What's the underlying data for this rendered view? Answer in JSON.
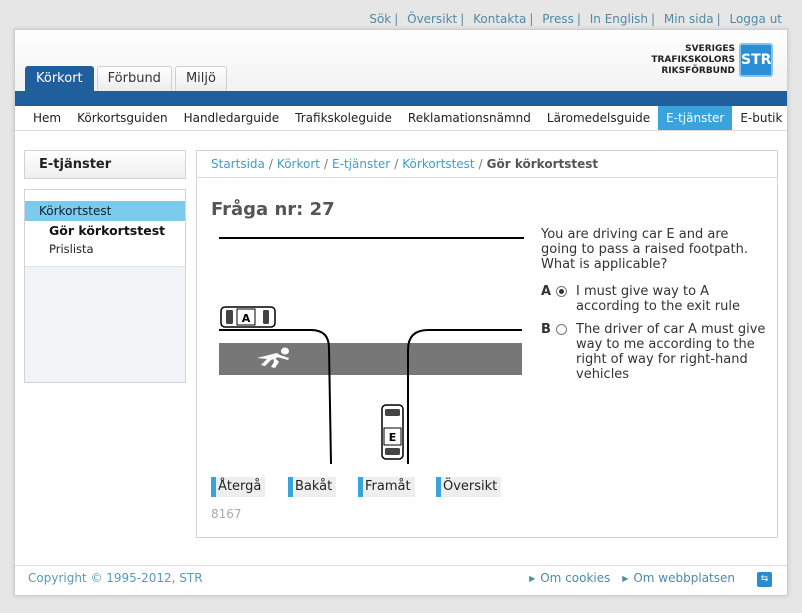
{
  "toplinks": [
    "Sök",
    "Översikt",
    "Kontakta",
    "Press",
    "In English",
    "Min sida",
    "Logga ut"
  ],
  "tabs": [
    {
      "label": "Körkort",
      "active": true
    },
    {
      "label": "Förbund",
      "active": false
    },
    {
      "label": "Miljö",
      "active": false
    }
  ],
  "logo": {
    "line1": "SVERIGES",
    "line2": "TRAFIKSKOLORS",
    "line3": "RIKSFÖRBUND",
    "box": "STR"
  },
  "mainnav": [
    "Hem",
    "Körkortsguiden",
    "Handledarguide",
    "Trafikskoleguide",
    "Reklamationsnämnd",
    "Läromedelsguide",
    "E-tjänster",
    "E-butik"
  ],
  "sidebar": {
    "title": "E-tjänster",
    "items": [
      "Körkortstest",
      "Gör körkortstest",
      "Prislista"
    ]
  },
  "breadcrumb": {
    "links": [
      "Startsida",
      "Körkort",
      "E-tjänster",
      "Körkortstest"
    ],
    "current": "Gör körkortstest"
  },
  "question": {
    "title": "Fråga nr: 27",
    "text": "You are driving car E and are going to pass a raised footpath. What is applicable?",
    "answers": [
      {
        "letter": "A",
        "text": "I must give way to A according to the exit rule",
        "checked": true
      },
      {
        "letter": "B",
        "text": "The driver of car A must give way to me according to the right of way for right-hand vehicles",
        "checked": false
      }
    ],
    "car_labels": {
      "car_a": "A",
      "car_e": "E"
    }
  },
  "buttons": [
    "Återgå",
    "Bakåt",
    "Framåt",
    "Översikt"
  ],
  "code": "8167",
  "footer": {
    "copyright": "Copyright © 1995-2012, STR",
    "links": [
      "Om cookies",
      "Om webbplatsen"
    ]
  },
  "colors": {
    "brand_blue": "#1f5f9e",
    "accent": "#3aa3dd",
    "link": "#3f9ec9"
  }
}
